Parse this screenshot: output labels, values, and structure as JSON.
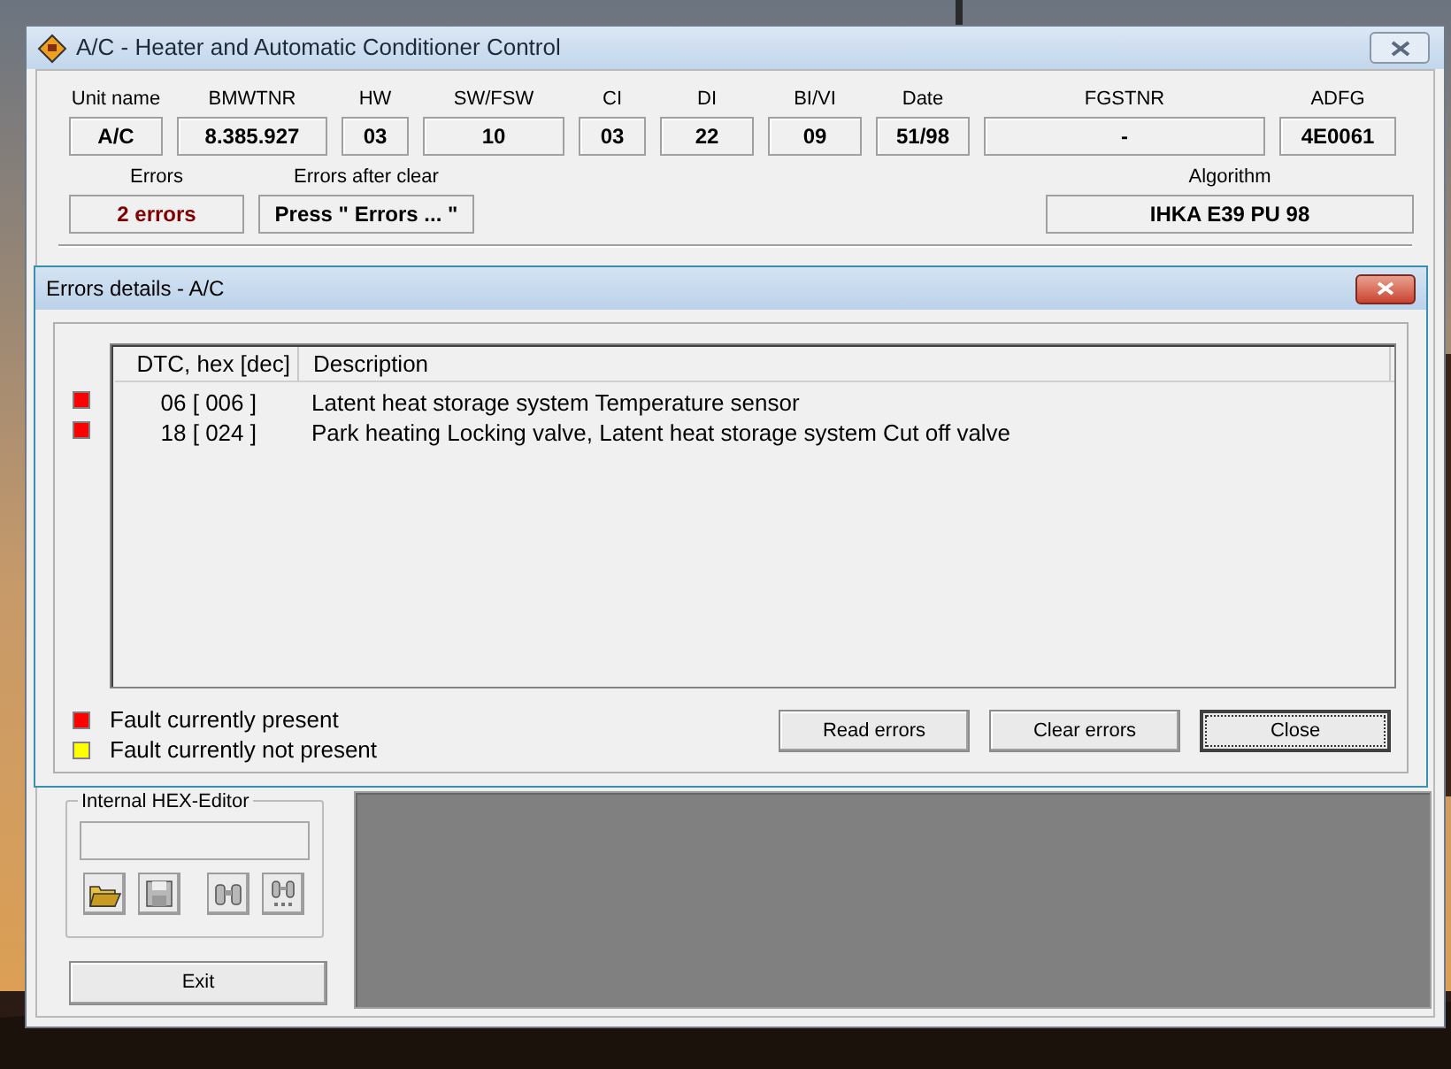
{
  "window": {
    "title": "A/C - Heater and Automatic Conditioner Control"
  },
  "info_fields": [
    {
      "label": "Unit name",
      "value": "A/C"
    },
    {
      "label": "BMWTNR",
      "value": "8.385.927"
    },
    {
      "label": "HW",
      "value": "03"
    },
    {
      "label": "SW/FSW",
      "value": "10"
    },
    {
      "label": "CI",
      "value": "03"
    },
    {
      "label": "DI",
      "value": "22"
    },
    {
      "label": "BI/VI",
      "value": "09"
    },
    {
      "label": "Date",
      "value": "51/98"
    },
    {
      "label": "FGSTNR",
      "value": "-"
    },
    {
      "label": "ADFG",
      "value": "4E0061"
    }
  ],
  "errors": {
    "label": "Errors",
    "value": "2 errors"
  },
  "errors_after_clear": {
    "label": "Errors after clear",
    "value": "Press \" Errors ... \""
  },
  "algorithm": {
    "label": "Algorithm",
    "value": "IHKA E39 PU 98"
  },
  "hex_editor": {
    "title": "Internal HEX-Editor",
    "buttons": [
      {
        "kind": "open",
        "disabled": false
      },
      {
        "kind": "save",
        "disabled": true
      },
      {
        "kind": "find",
        "disabled": true
      },
      {
        "kind": "find_next",
        "disabled": true
      }
    ]
  },
  "exit_button": "Exit",
  "dialog": {
    "title": "Errors details - A/C",
    "columns": [
      "DTC, hex [dec]",
      "Description"
    ],
    "rows": [
      {
        "color": "#ff0000",
        "code": "06 [ 006 ]",
        "description": "Latent heat storage system Temperature sensor"
      },
      {
        "color": "#ff0000",
        "code": "18 [ 024 ]",
        "description": "Park heating Locking valve, Latent heat storage system Cut off valve"
      }
    ],
    "legend": [
      {
        "color": "#ff0000",
        "label": "Fault currently present"
      },
      {
        "color": "#ffff00",
        "label": "Fault currently not present"
      }
    ],
    "buttons": [
      {
        "label": "Read errors",
        "focused": false
      },
      {
        "label": "Clear errors",
        "focused": false
      },
      {
        "label": "Close",
        "focused": true
      }
    ]
  }
}
